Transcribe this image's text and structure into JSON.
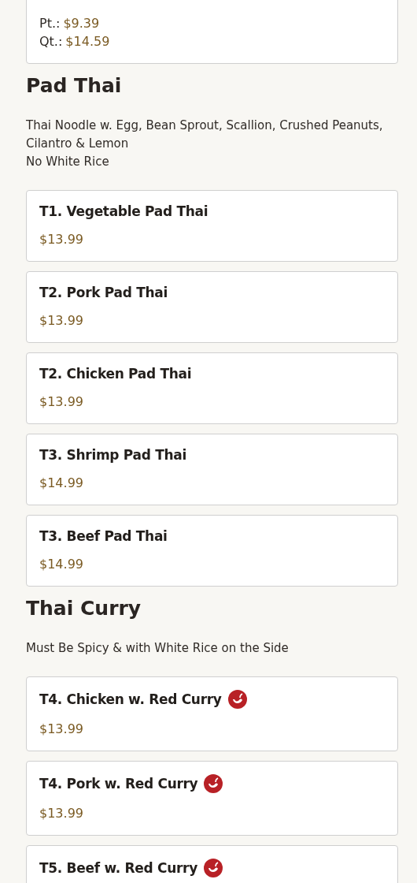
{
  "sections": [
    {
      "items": [
        {
          "spicy": false,
          "prices": [
            {
              "label": "Pt.:",
              "amount": "$9.39"
            },
            {
              "label": "Qt.:",
              "amount": "$14.59"
            }
          ]
        }
      ]
    },
    {
      "title": "Pad Thai",
      "description": [
        "Thai Noodle w. Egg, Bean Sprout, Scallion, Crushed Peanuts, Cilantro & Lemon",
        "No White Rice"
      ],
      "items": [
        {
          "name": "T1. Vegetable Pad Thai",
          "spicy": false,
          "prices": [
            {
              "amount": "$13.99"
            }
          ]
        },
        {
          "name": "T2. Pork Pad Thai",
          "spicy": false,
          "prices": [
            {
              "amount": "$13.99"
            }
          ]
        },
        {
          "name": "T2. Chicken Pad Thai",
          "spicy": false,
          "prices": [
            {
              "amount": "$13.99"
            }
          ]
        },
        {
          "name": "T3. Shrimp Pad Thai",
          "spicy": false,
          "prices": [
            {
              "amount": "$14.99"
            }
          ]
        },
        {
          "name": "T3. Beef Pad Thai",
          "spicy": false,
          "prices": [
            {
              "amount": "$14.99"
            }
          ]
        }
      ]
    },
    {
      "title": "Thai Curry",
      "description": [
        "Must Be Spicy & with White Rice on the Side"
      ],
      "items": [
        {
          "name": "T4. Chicken w. Red Curry",
          "spicy": true,
          "prices": [
            {
              "amount": "$13.99"
            }
          ]
        },
        {
          "name": "T4. Pork w. Red Curry",
          "spicy": true,
          "prices": [
            {
              "amount": "$13.99"
            }
          ]
        },
        {
          "name": "T5. Beef w. Red Curry",
          "spicy": true
        }
      ]
    }
  ]
}
